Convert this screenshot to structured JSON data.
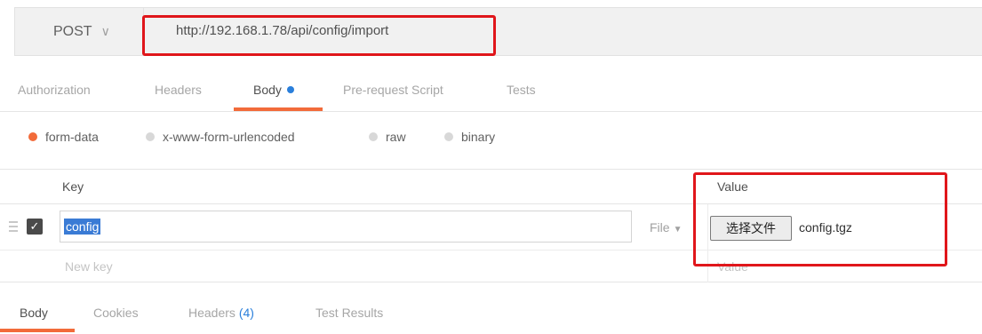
{
  "request": {
    "method": "POST",
    "url": "http://192.168.1.78/api/config/import"
  },
  "tabs": [
    {
      "label": "Authorization"
    },
    {
      "label": "Headers"
    },
    {
      "label": "Body",
      "active": true
    },
    {
      "label": "Pre-request Script"
    },
    {
      "label": "Tests"
    }
  ],
  "body_types": [
    {
      "label": "form-data",
      "selected": true
    },
    {
      "label": "x-www-form-urlencoded"
    },
    {
      "label": "raw"
    },
    {
      "label": "binary"
    }
  ],
  "table": {
    "headers": {
      "key": "Key",
      "value": "Value"
    },
    "rows": [
      {
        "key": "config",
        "type": "File",
        "button": "选择文件",
        "file": "config.tgz"
      }
    ],
    "new_key_placeholder": "New key",
    "new_value_placeholder": "Value"
  },
  "response_tabs": [
    {
      "label": "Body",
      "active": true
    },
    {
      "label": "Cookies"
    },
    {
      "label": "Headers",
      "count": "(4)"
    },
    {
      "label": "Test Results"
    }
  ],
  "colors": {
    "accent": "#f26b3a",
    "highlight": "#e0161b",
    "link": "#2a7fdb"
  }
}
